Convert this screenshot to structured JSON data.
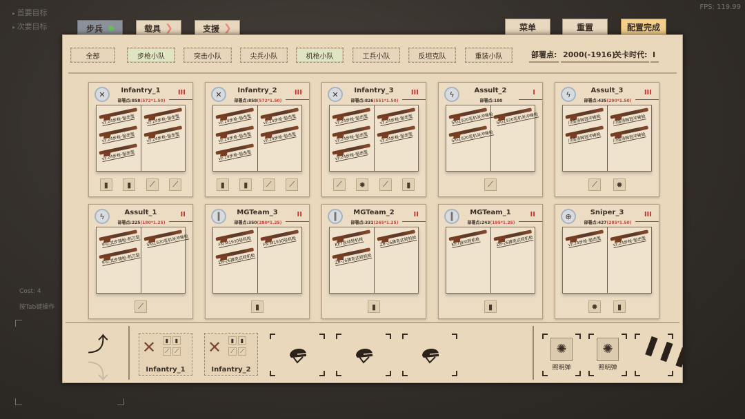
{
  "hud": {
    "objectives": [
      "首要目标",
      "次要目标"
    ],
    "fps": "FPS: 119.99",
    "cost": "Cost: 4",
    "hint": "按Tab键操作"
  },
  "tabs": [
    {
      "label": "步兵",
      "active": true
    },
    {
      "label": "载具",
      "active": false
    },
    {
      "label": "支援",
      "active": false
    }
  ],
  "actions": {
    "menu": "菜单",
    "reset": "重置",
    "done": "配置完成"
  },
  "filters": [
    {
      "label": "全部",
      "on": false
    },
    {
      "label": "步枪小队",
      "on": true
    },
    {
      "label": "突击小队",
      "on": false
    },
    {
      "label": "尖兵小队",
      "on": false
    },
    {
      "label": "机枪小队",
      "on": true
    },
    {
      "label": "工兵小队",
      "on": false
    },
    {
      "label": "反坦克队",
      "on": false
    },
    {
      "label": "重装小队",
      "on": false
    }
  ],
  "deploy": {
    "label": "部署点:",
    "value": "2000(-1916)",
    "era_label": "关卡时代:",
    "era": "I"
  },
  "colors": {
    "panel": "#ead8bd",
    "accent_done": "#f2cf8a",
    "active_tab": "#8b919a",
    "multiplier_red": "#d0413a",
    "filter_on": "#dfe4c2"
  },
  "cards": [
    {
      "name": "Infantry_1",
      "pts_label": "部署点:",
      "pts": "858",
      "mul": "(572*1.50)",
      "rank": "III",
      "emblem": "crossed-rifles",
      "left": [
        "vz.24步枪-狙击型",
        "vz.24步枪-狙击型",
        "vz.24步枪-狙击型"
      ],
      "right": [
        "vz.24步枪-狙击型",
        "vz.24步枪-狙击型"
      ],
      "eq": [
        "canister-grenade",
        "canister-grenade",
        "stick-grenade",
        "stick-grenade"
      ]
    },
    {
      "name": "Infantry_2",
      "pts_label": "部署点:",
      "pts": "858",
      "mul": "(572*1.50)",
      "rank": "III",
      "emblem": "crossed-rifles",
      "left": [
        "vz.24步枪-狙击型",
        "vz.24步枪-狙击型",
        "vz.24步枪-狙击型"
      ],
      "right": [
        "vz.24步枪-狙击型",
        "vz.24步枪-狙击型"
      ],
      "eq": [
        "canister-grenade",
        "canister-grenade",
        "stick-grenade",
        "stick-grenade"
      ]
    },
    {
      "name": "Infantry_3",
      "pts_label": "部署点:",
      "pts": "826",
      "mul": "(551*1.50)",
      "rank": "III",
      "emblem": "crossed-rifles",
      "left": [
        "vz.24步枪-狙击型",
        "vz.24步枪-狙击型",
        "vz.24步枪-狙击型"
      ],
      "right": [
        "vz.24步枪-狙击型",
        "vz.24步枪-狙击型"
      ],
      "eq": [
        "stick-grenade",
        "frag-grenade",
        "stick-grenade",
        "canister-grenade"
      ]
    },
    {
      "name": "Assult_2",
      "pts_label": "部署点:",
      "pts": "180",
      "mul": "",
      "rank": "I",
      "emblem": "lightning",
      "left": [
        "SIG1920花机关冲锋枪",
        "SIG1920花机关冲锋枪"
      ],
      "right": [
        "SIG1920花机关冲锋枪"
      ],
      "eq": [
        "stick-grenade"
      ]
    },
    {
      "name": "Assult_3",
      "pts_label": "部署点:",
      "pts": "435",
      "mul": "(290*1.50)",
      "rank": "III",
      "emblem": "lightning",
      "left": [
        "川造汤姆逊冲锋枪",
        "川造汤姆逊冲锋枪"
      ],
      "right": [
        "川造汤姆逊冲锋枪",
        "川造汤姆逊冲锋枪"
      ],
      "eq": [
        "stick-grenade",
        "frag-grenade"
      ]
    },
    {
      "name": "Assult_1",
      "pts_label": "部署点:",
      "pts": "225",
      "mul": "(180*1.25)",
      "rank": "II",
      "emblem": "lightning",
      "left": [
        "中正式步骑枪-刺刀型",
        "中正式步骑枪-刺刀型"
      ],
      "right": [
        "SIG1920花机关冲锋枪"
      ],
      "eq": [
        "stick-grenade"
      ]
    },
    {
      "name": "MGTeam_3",
      "pts_label": "部署点:",
      "pts": "350",
      "mul": "(280*1.25)",
      "rank": "II",
      "emblem": "ammo-belt",
      "left": [
        "FN M1930轻机枪",
        "ZB-26捷克式轻机枪"
      ],
      "right": [
        "FN M1930轻机枪"
      ],
      "eq": [
        "canister-grenade"
      ]
    },
    {
      "name": "MGTeam_2",
      "pts_label": "部署点:",
      "pts": "331",
      "mul": "(265*1.25)",
      "rank": "II",
      "emblem": "ammo-belt",
      "left": [
        "KE7自动轻机枪",
        "ZB-26捷克式轻机枪"
      ],
      "right": [
        "ZB-26捷克式轻机枪"
      ],
      "eq": [
        "canister-grenade"
      ]
    },
    {
      "name": "MGTeam_1",
      "pts_label": "部署点:",
      "pts": "243",
      "mul": "(195*1.25)",
      "rank": "II",
      "emblem": "ammo-belt",
      "left": [
        "KE7自动轻机枪"
      ],
      "right": [
        "ZB-26捷克式轻机枪"
      ],
      "eq": [
        "canister-grenade"
      ]
    },
    {
      "name": "Sniper_3",
      "pts_label": "部署点:",
      "pts": "427",
      "mul": "(285*1.50)",
      "rank": "III",
      "emblem": "scope",
      "left": [
        "vz.24步枪-狙击型"
      ],
      "right": [
        "vz.24步枪-狙击型"
      ],
      "eq": [
        "frag-grenade",
        "canister-grenade"
      ]
    }
  ],
  "bottom": {
    "squads": [
      {
        "name": "Infantry_1"
      },
      {
        "name": "Infantry_2"
      }
    ],
    "empty_slots": 3,
    "support": [
      {
        "label": "照明弹",
        "icon": "flare"
      },
      {
        "label": "照明弹",
        "icon": "flare"
      },
      {
        "label": "",
        "icon": "artillery-shells"
      }
    ]
  }
}
